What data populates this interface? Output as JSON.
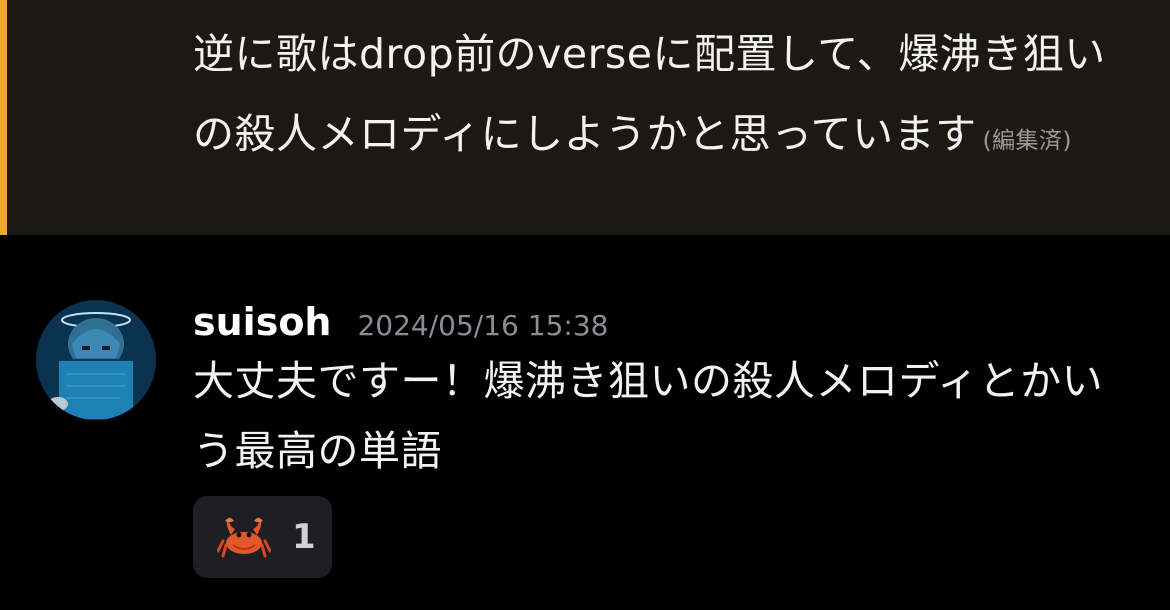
{
  "highlighted_message": {
    "text": "逆に歌はdrop前のverseに配置して、爆沸き狙いの殺人メロディにしようかと思っています",
    "edited_label": "(編集済)",
    "accent_color": "#f0a832",
    "background_color": "#1c1913"
  },
  "reply": {
    "username": "suisoh",
    "timestamp": "2024/05/16 15:38",
    "text": "大丈夫ですー！爆沸き狙いの殺人メロディとかいう最高の単語",
    "avatar_icon": "user-avatar"
  },
  "reaction": {
    "icon": "crab-emoji",
    "count": "1"
  }
}
